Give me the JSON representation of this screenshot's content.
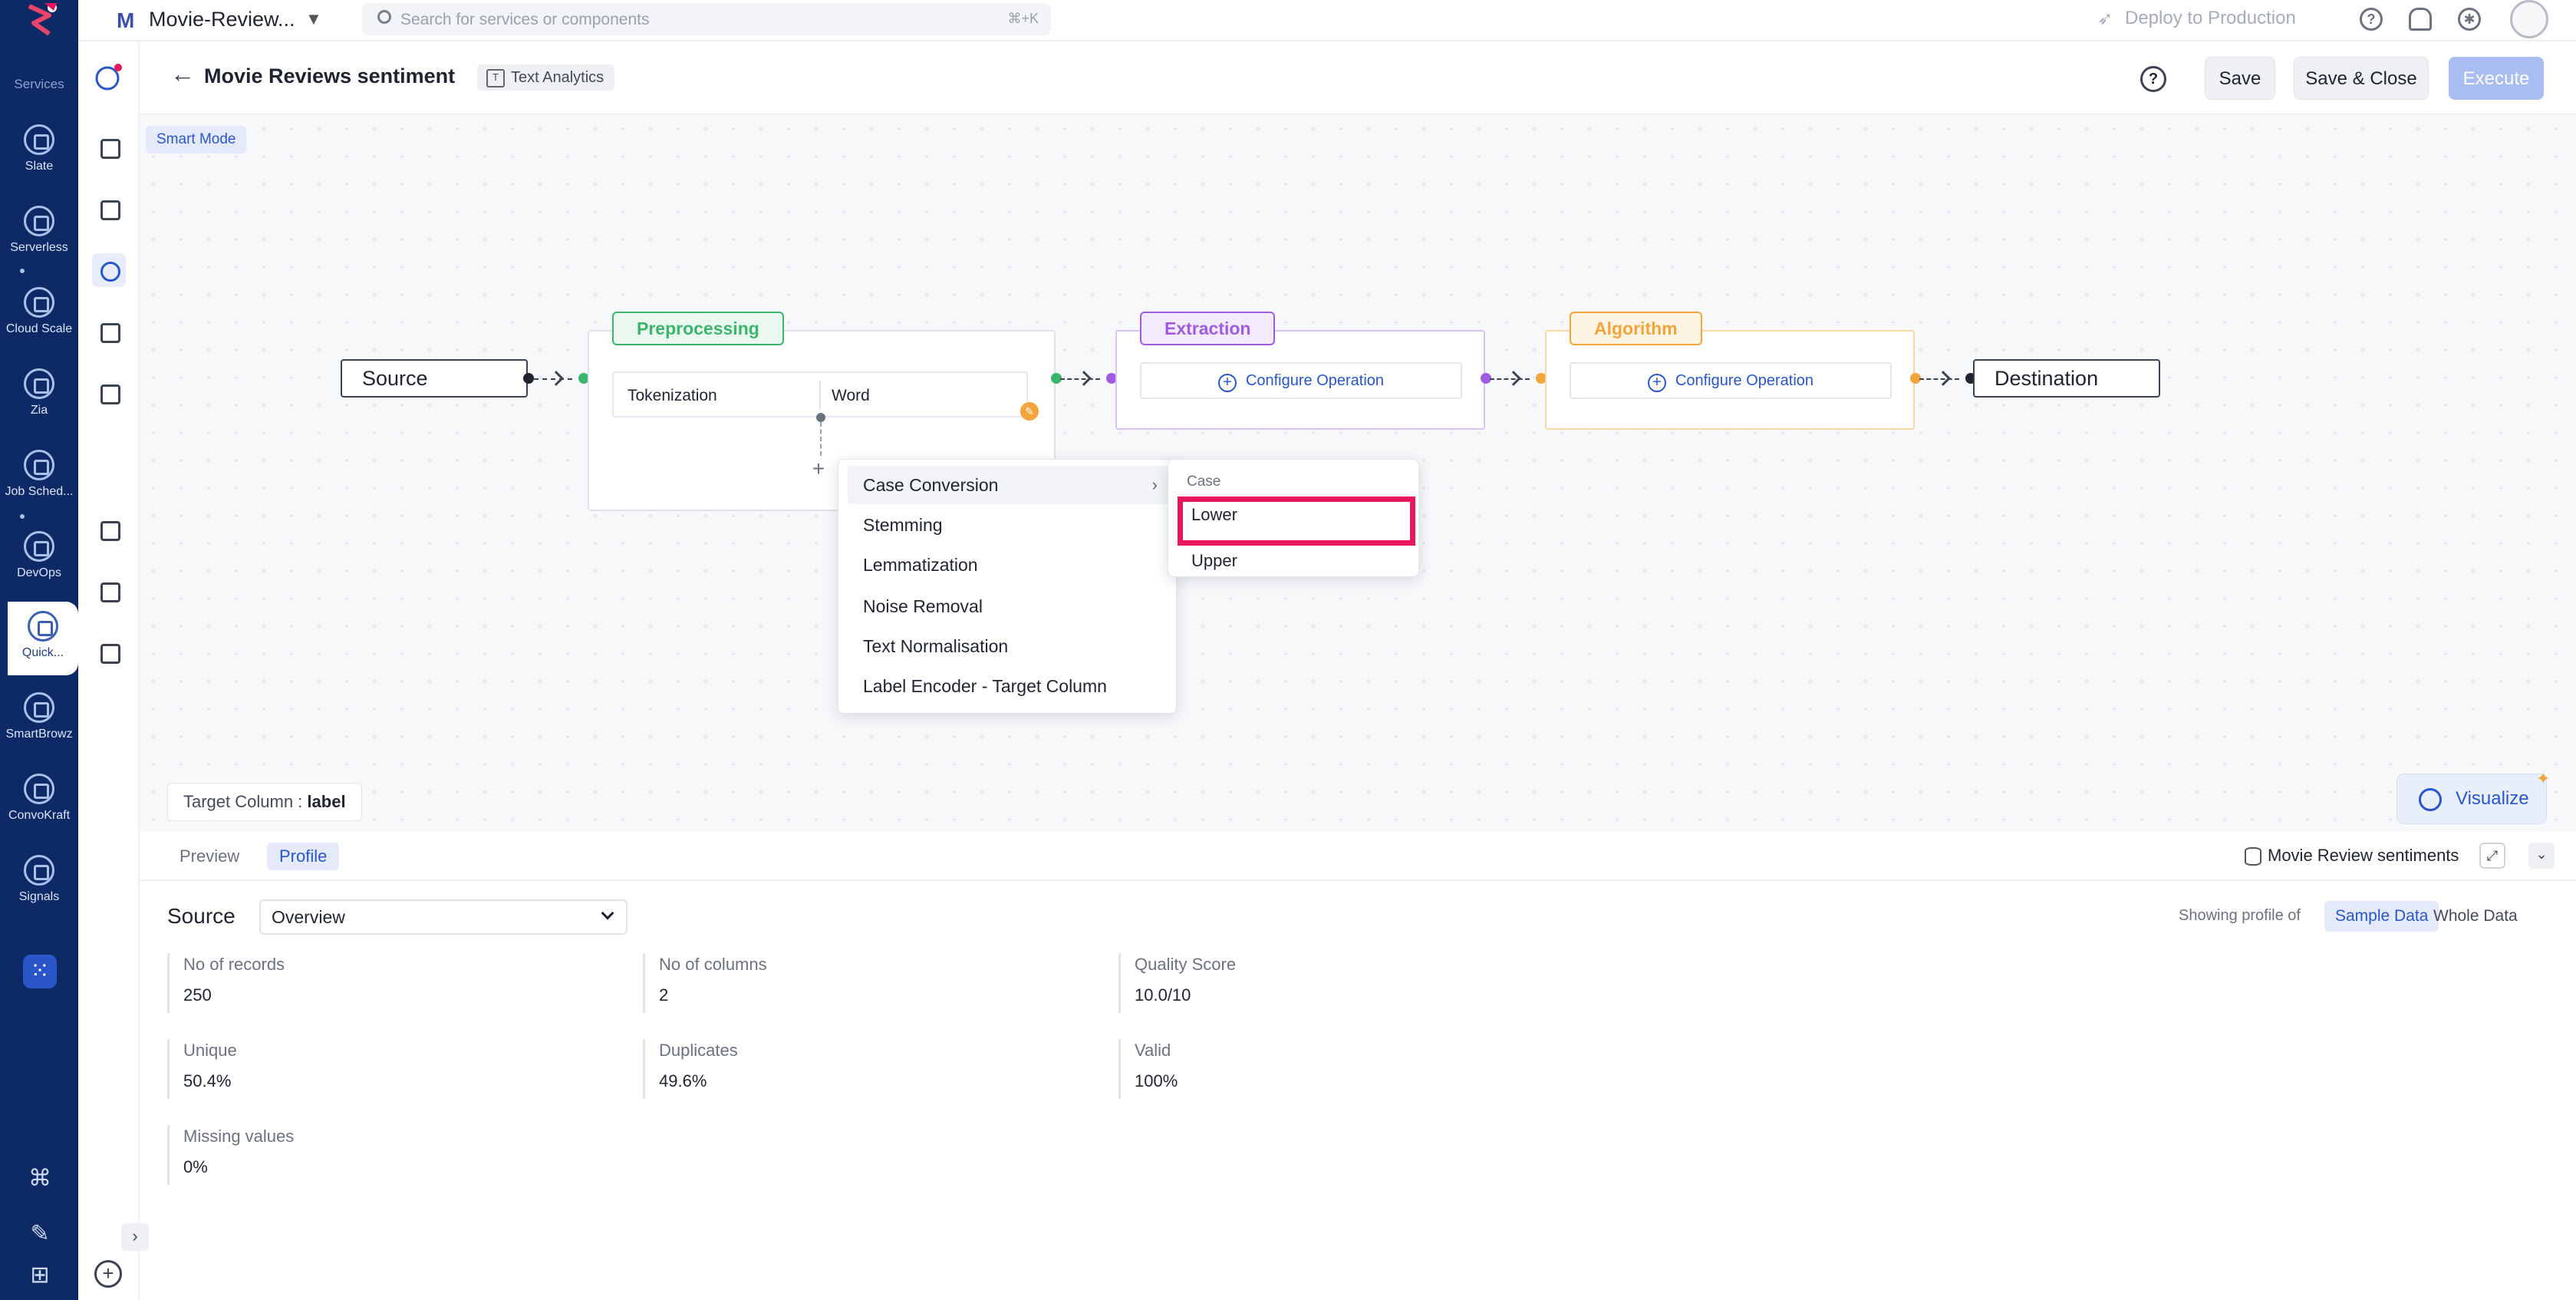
{
  "rail": {
    "caption": "Services",
    "items": [
      {
        "label": "Slate"
      },
      {
        "label": "Serverless"
      },
      {
        "label": "Cloud Scale"
      },
      {
        "label": "Zia"
      },
      {
        "label": "Job Sched..."
      },
      {
        "label": "DevOps"
      },
      {
        "label": "Quick..."
      },
      {
        "label": "SmartBrowz"
      },
      {
        "label": "ConvoKraft"
      },
      {
        "label": "Signals"
      }
    ]
  },
  "topbar": {
    "project_badge": "M",
    "project_name": "Movie-Review...",
    "search_placeholder": "Search for services or components",
    "search_shortcut": "⌘+K",
    "deploy_label": "Deploy to Production"
  },
  "header": {
    "title": "Movie Reviews sentiment",
    "chip": "Text Analytics",
    "save": "Save",
    "save_close": "Save & Close",
    "execute": "Execute"
  },
  "canvas": {
    "smart_mode": "Smart Mode",
    "source": "Source",
    "destination": "Destination",
    "stages": {
      "preprocessing": "Preprocessing",
      "extraction": "Extraction",
      "algorithm": "Algorithm"
    },
    "tokenization": {
      "label": "Tokenization",
      "value": "Word"
    },
    "configure_operation": "Configure Operation",
    "menu": [
      "Case Conversion",
      "Stemming",
      "Lemmatization",
      "Noise Removal",
      "Text Normalisation",
      "Label Encoder - Target Column"
    ],
    "submenu": {
      "header": "Case",
      "items": [
        "Lower",
        "Upper"
      ]
    },
    "target_column": {
      "label": "Target Column :",
      "value": "label"
    },
    "visualize": "Visualize"
  },
  "bottom": {
    "tabs": [
      "Preview",
      "Profile"
    ],
    "dataset": "Movie Review sentiments",
    "source_label": "Source",
    "view_select": "Overview",
    "showing_label": "Showing profile of",
    "toggle": [
      "Sample Data",
      "Whole Data"
    ],
    "stats": [
      {
        "label": "No of records",
        "value": "250"
      },
      {
        "label": "No of columns",
        "value": "2"
      },
      {
        "label": "Quality Score",
        "value": "10.0/10"
      },
      {
        "label": "Unique",
        "value": "50.4%"
      },
      {
        "label": "Duplicates",
        "value": "49.6%"
      },
      {
        "label": "Valid",
        "value": "100%"
      },
      {
        "label": "Missing values",
        "value": "0%"
      }
    ]
  },
  "colors": {
    "rail_bg": "#0d2a66",
    "accent": "#2a56c9",
    "preprocessing": "#3bb56b",
    "extraction": "#a05ce0",
    "algorithm": "#f1a53a",
    "highlight": "#e8175d"
  }
}
